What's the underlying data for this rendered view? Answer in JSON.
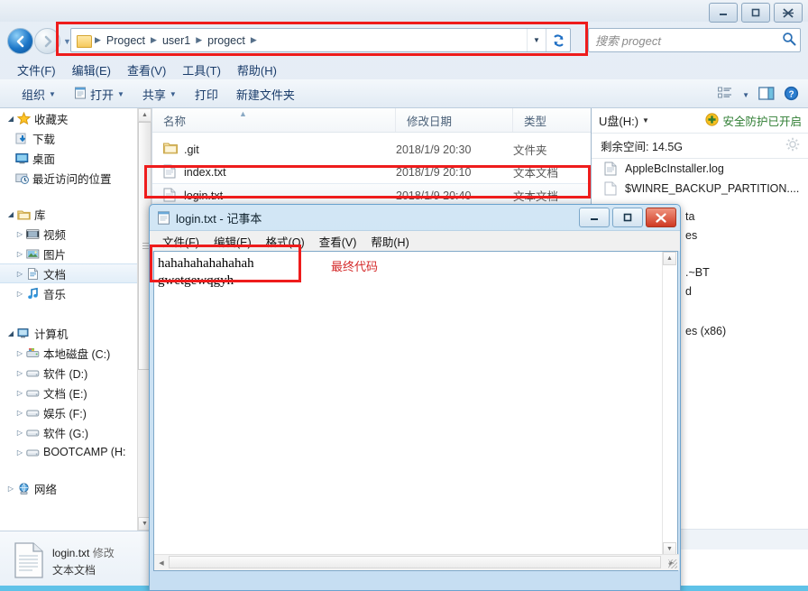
{
  "window": {
    "controls": {
      "minimize": "—",
      "maximize": "❐",
      "close": "✕"
    }
  },
  "nav": {
    "back_title": "后退",
    "forward_title": "前进",
    "history_caret": "▼",
    "address": {
      "folder_icon": "folder-icon",
      "crumbs": [
        "Progect",
        "user1",
        "progect"
      ],
      "separator": "▶",
      "dropdown_caret": "▼",
      "refresh_icon": "refresh-icon"
    },
    "search": {
      "placeholder": "搜索 progect",
      "value": "",
      "icon": "search-icon"
    }
  },
  "menubar": {
    "items": [
      "文件(F)",
      "编辑(E)",
      "查看(V)",
      "工具(T)",
      "帮助(H)"
    ]
  },
  "toolbar": {
    "organize": "组织",
    "open": "打开",
    "share": "共享",
    "print": "打印",
    "new_folder": "新建文件夹",
    "caret": "▼",
    "view_icon": "view-list-icon",
    "preview_icon": "preview-pane-icon",
    "help_icon": "help-icon"
  },
  "sidebar": {
    "favorites": {
      "label": "收藏夹",
      "icon": "star-icon",
      "items": [
        {
          "label": "下载",
          "icon": "download-icon"
        },
        {
          "label": "桌面",
          "icon": "desktop-icon"
        },
        {
          "label": "最近访问的位置",
          "icon": "recent-places-icon"
        }
      ]
    },
    "libraries": {
      "label": "库",
      "icon": "library-icon",
      "items": [
        {
          "label": "视频",
          "icon": "video-icon"
        },
        {
          "label": "图片",
          "icon": "pictures-icon"
        },
        {
          "label": "文档",
          "icon": "documents-icon",
          "selected": true
        },
        {
          "label": "音乐",
          "icon": "music-icon"
        }
      ]
    },
    "computer": {
      "label": "计算机",
      "icon": "computer-icon",
      "items": [
        {
          "label": "本地磁盘 (C:)",
          "icon": "system-drive-icon"
        },
        {
          "label": "软件 (D:)",
          "icon": "drive-icon"
        },
        {
          "label": "文档 (E:)",
          "icon": "drive-icon"
        },
        {
          "label": "娱乐 (F:)",
          "icon": "drive-icon"
        },
        {
          "label": "软件 (G:)",
          "icon": "drive-icon"
        },
        {
          "label": "BOOTCAMP (H:",
          "icon": "drive-icon"
        }
      ]
    },
    "network": {
      "label": "网络",
      "icon": "network-icon"
    },
    "expander_closed": "▷",
    "expander_open": "◢"
  },
  "filelist": {
    "columns": [
      "名称",
      "修改日期",
      "类型"
    ],
    "sort_indicator": "▲",
    "rows": [
      {
        "name": ".git",
        "date": "2018/1/9 20:30",
        "type": "文件夹",
        "icon": "folder-icon",
        "selected": false
      },
      {
        "name": "index.txt",
        "date": "2018/1/9 20:10",
        "type": "文本文档",
        "icon": "textfile-icon",
        "selected": false
      },
      {
        "name": "login.txt",
        "date": "2018/1/9 20:40",
        "type": "文本文档",
        "icon": "textfile-icon",
        "selected": true
      }
    ]
  },
  "details": {
    "file_name": "login.txt",
    "modified_label": "修改",
    "file_type": "文本文档",
    "icon": "textfile-large-icon"
  },
  "usb_panel": {
    "drive_label": "U盘(H:)",
    "drive_caret": "▼",
    "protection_text": "安全防护已开启",
    "protection_icon": "shield-ok-icon",
    "free_space_label": "剩余空间: 14.5G",
    "settings_icon": "gear-icon",
    "files": [
      {
        "name": "AppleBcInstaller.log",
        "icon": "log-file-icon"
      },
      {
        "name": "$WINRE_BACKUP_PARTITION....",
        "icon": "blank-file-icon"
      }
    ],
    "hidden_fragments": [
      "ta",
      "es",
      ".~BT",
      "d",
      "es (x86)"
    ]
  },
  "notepad": {
    "title": "login.txt - 记事本",
    "icon": "notepad-icon",
    "controls": {
      "minimize": "—",
      "maximize": "❐",
      "close": "✕"
    },
    "menu": [
      "文件(F)",
      "编辑(E)",
      "格式(O)",
      "查看(V)",
      "帮助(H)"
    ],
    "text": "hahahahahahahah\ngwetgewqgyh",
    "annotation": "最终代码"
  },
  "annotations": {
    "color": "#ee1c1c",
    "boxes": [
      "address-bar",
      "selected-file-row",
      "notepad-text"
    ]
  }
}
